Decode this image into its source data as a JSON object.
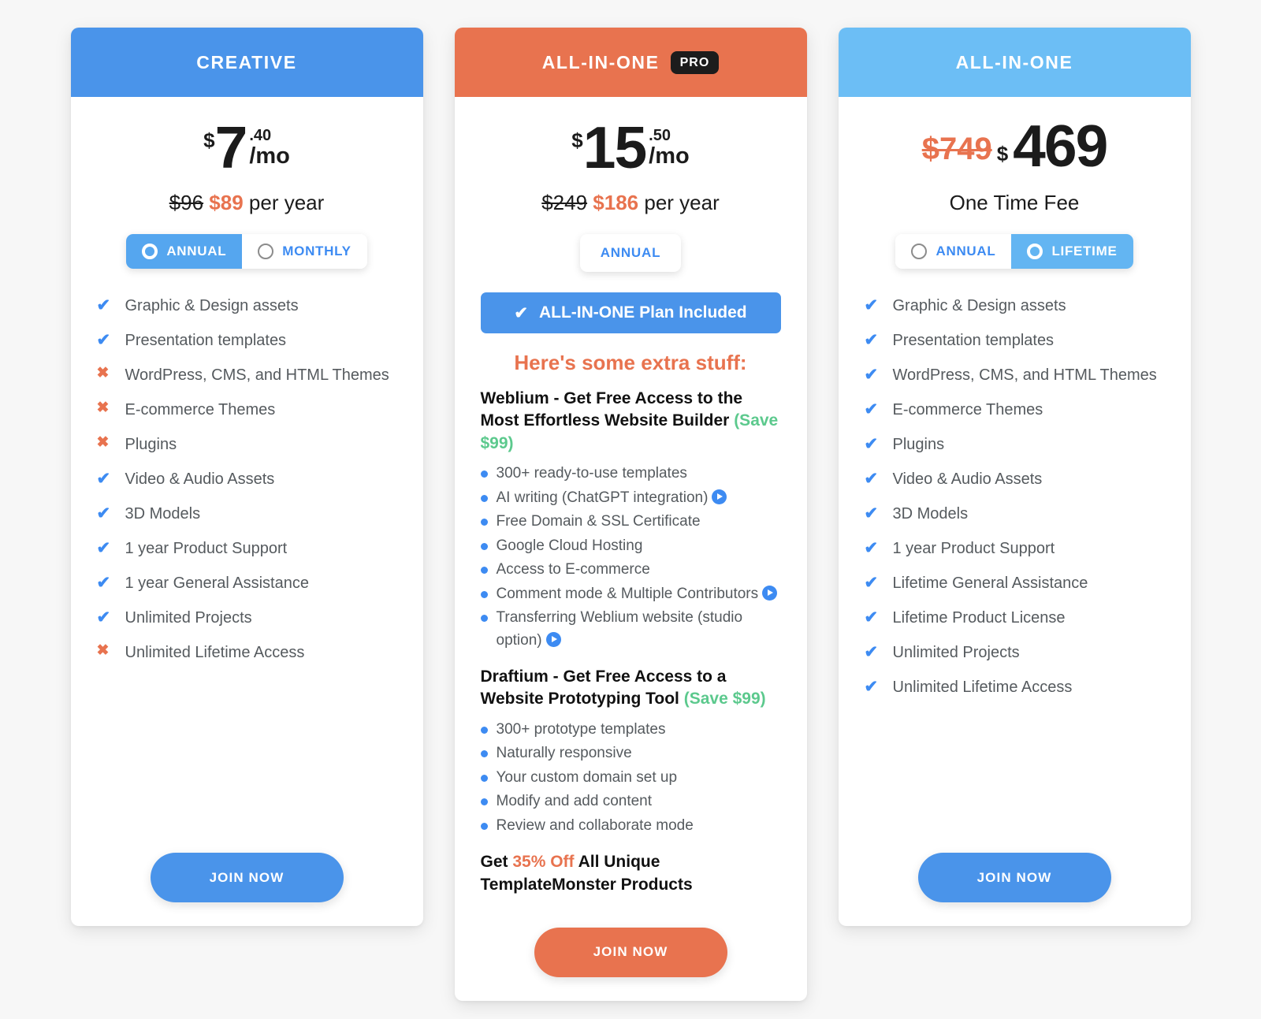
{
  "colors": {
    "blue_primary": "#4a94ea",
    "blue_light": "#6cbef5",
    "orange": "#e8734f",
    "green": "#5cc98d",
    "text": "#555a5e",
    "background": "#f7f7f7"
  },
  "cards": [
    {
      "id": "creative",
      "header": {
        "title": "CREATIVE",
        "badge": null
      },
      "price": {
        "currency": "$",
        "amount": "7",
        "cents": ".40",
        "period": "/mo"
      },
      "peryear": {
        "old": "$96",
        "new": "$89",
        "suffix": "per year"
      },
      "toggle": {
        "type": "two-option",
        "options": [
          {
            "label": "ANNUAL",
            "selected": true
          },
          {
            "label": "MONTHLY",
            "selected": false
          }
        ]
      },
      "features": [
        {
          "mark": "yes",
          "label": "Graphic & Design assets"
        },
        {
          "mark": "yes",
          "label": "Presentation templates"
        },
        {
          "mark": "no",
          "label": "WordPress, CMS, and HTML Themes"
        },
        {
          "mark": "no",
          "label": "E-commerce Themes"
        },
        {
          "mark": "no",
          "label": "Plugins"
        },
        {
          "mark": "yes",
          "label": "Video & Audio Assets"
        },
        {
          "mark": "yes",
          "label": "3D Models"
        },
        {
          "mark": "yes",
          "label": "1 year Product Support"
        },
        {
          "mark": "yes",
          "label": "1 year General Assistance"
        },
        {
          "mark": "yes",
          "label": "Unlimited Projects"
        },
        {
          "mark": "no",
          "label": "Unlimited Lifetime Access"
        }
      ],
      "cta": {
        "label": "JOIN NOW",
        "color": "#4a94ea"
      }
    },
    {
      "id": "pro",
      "header": {
        "title": "ALL-IN-ONE",
        "badge": "PRO"
      },
      "price": {
        "currency": "$",
        "amount": "15",
        "cents": ".50",
        "period": "/mo"
      },
      "peryear": {
        "old": "$249",
        "new": "$186",
        "suffix": "per year"
      },
      "toggle": {
        "type": "single-pill",
        "options": [
          {
            "label": "ANNUAL",
            "selected": true
          }
        ]
      },
      "included_banner": "ALL-IN-ONE Plan Included",
      "extra_heading": "Here's some extra stuff:",
      "sections": [
        {
          "title": "Weblium - Get Free Access to the Most Effortless Website Builder",
          "save": "(Save $99)",
          "items": [
            {
              "label": "300+ ready-to-use templates",
              "play": false
            },
            {
              "label": "AI writing (ChatGPT integration)",
              "play": true
            },
            {
              "label": "Free Domain & SSL Certificate",
              "play": false
            },
            {
              "label": "Google Cloud Hosting",
              "play": false
            },
            {
              "label": "Access to E-commerce",
              "play": false
            },
            {
              "label": "Comment mode & Multiple Contributors",
              "play": true
            },
            {
              "label": "Transferring Weblium website (studio option)",
              "play": true
            }
          ]
        },
        {
          "title": "Draftium - Get Free Access to a Website Prototyping Tool",
          "save": "(Save $99)",
          "items": [
            {
              "label": "300+ prototype templates",
              "play": false
            },
            {
              "label": "Naturally responsive",
              "play": false
            },
            {
              "label": "Your custom domain set up",
              "play": false
            },
            {
              "label": "Modify and add content",
              "play": false
            },
            {
              "label": "Review and collaborate mode",
              "play": false
            }
          ]
        }
      ],
      "promo": {
        "prefix": "Get ",
        "highlight": "35% Off",
        "suffix": " All Unique TemplateMonster Products"
      },
      "cta": {
        "label": "JOIN NOW",
        "color": "#e8734f"
      }
    },
    {
      "id": "allinone",
      "header": {
        "title": "ALL-IN-ONE",
        "badge": null
      },
      "price": {
        "currency": "$",
        "old_amount": "$749",
        "amount": "469"
      },
      "onetime_label": "One Time Fee",
      "toggle": {
        "type": "two-option",
        "options": [
          {
            "label": "ANNUAL",
            "selected": false
          },
          {
            "label": "LIFETIME",
            "selected": true
          }
        ]
      },
      "features": [
        {
          "mark": "yes",
          "label": "Graphic & Design assets"
        },
        {
          "mark": "yes",
          "label": "Presentation templates"
        },
        {
          "mark": "yes",
          "label": "WordPress, CMS, and HTML Themes"
        },
        {
          "mark": "yes",
          "label": "E-commerce Themes"
        },
        {
          "mark": "yes",
          "label": "Plugins"
        },
        {
          "mark": "yes",
          "label": "Video & Audio Assets"
        },
        {
          "mark": "yes",
          "label": "3D Models"
        },
        {
          "mark": "yes",
          "label": "1 year Product Support"
        },
        {
          "mark": "yes",
          "label": "Lifetime General Assistance"
        },
        {
          "mark": "yes",
          "label": "Lifetime Product License"
        },
        {
          "mark": "yes",
          "label": "Unlimited Projects"
        },
        {
          "mark": "yes",
          "label": "Unlimited Lifetime Access"
        }
      ],
      "cta": {
        "label": "JOIN NOW",
        "color": "#4a94ea"
      }
    }
  ],
  "icons": {
    "check": "✔",
    "cross": "✖",
    "play": "play-circle-icon"
  }
}
